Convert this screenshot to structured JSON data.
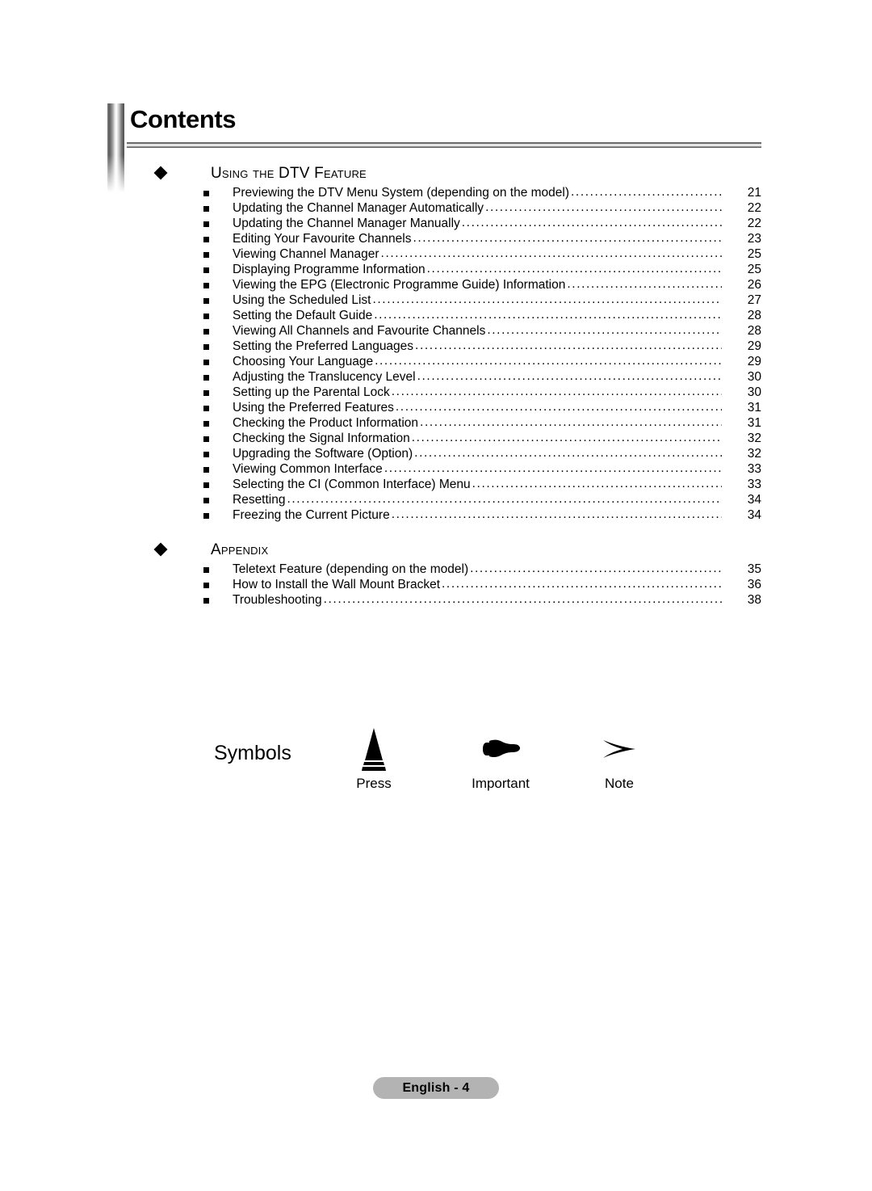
{
  "header": {
    "title": "Contents"
  },
  "toc": {
    "sections": [
      {
        "title": "Using the DTV Feature",
        "bullet_icon": "diamond-icon",
        "entries": [
          {
            "label": "Previewing the DTV Menu System (depending on the model)",
            "page": "21"
          },
          {
            "label": "Updating the Channel Manager Automatically",
            "page": "22"
          },
          {
            "label": "Updating the Channel Manager Manually",
            "page": "22"
          },
          {
            "label": "Editing Your Favourite Channels",
            "page": "23"
          },
          {
            "label": "Viewing Channel Manager",
            "page": "25"
          },
          {
            "label": "Displaying Programme Information",
            "page": "25"
          },
          {
            "label": "Viewing the EPG (Electronic Programme Guide) Information",
            "page": "26"
          },
          {
            "label": "Using the Scheduled List",
            "page": "27"
          },
          {
            "label": "Setting the Default Guide",
            "page": "28"
          },
          {
            "label": "Viewing All Channels and Favourite Channels",
            "page": "28"
          },
          {
            "label": "Setting the Preferred Languages",
            "page": "29"
          },
          {
            "label": "Choosing Your Language",
            "page": "29"
          },
          {
            "label": "Adjusting the Translucency Level",
            "page": "30"
          },
          {
            "label": "Setting up the Parental Lock",
            "page": "30"
          },
          {
            "label": "Using the Preferred Features",
            "page": "31"
          },
          {
            "label": "Checking the Product Information",
            "page": "31"
          },
          {
            "label": "Checking the Signal Information",
            "page": "32"
          },
          {
            "label": "Upgrading the Software (Option)",
            "page": "32"
          },
          {
            "label": "Viewing Common Interface",
            "page": "33"
          },
          {
            "label": "Selecting the CI (Common Interface) Menu",
            "page": "33"
          },
          {
            "label": "Resetting",
            "page": "34"
          },
          {
            "label": "Freezing the Current Picture",
            "page": "34"
          }
        ]
      },
      {
        "title": "Appendix",
        "bullet_icon": "diamond-icon",
        "entries": [
          {
            "label": "Teletext Feature (depending on the model)",
            "page": "35"
          },
          {
            "label": "How to Install the Wall Mount Bracket",
            "page": "36"
          },
          {
            "label": "Troubleshooting",
            "page": "38"
          }
        ]
      }
    ],
    "leader": "......................................................................................................................................................................................"
  },
  "symbols": {
    "label": "Symbols",
    "items": [
      {
        "icon": "press-triangle-icon",
        "caption": "Press"
      },
      {
        "icon": "pointing-hand-icon",
        "caption": "Important"
      },
      {
        "icon": "arrowhead-icon",
        "caption": "Note"
      }
    ]
  },
  "footer": {
    "text": "English - 4",
    "pill_color": "#b3b3b3"
  }
}
